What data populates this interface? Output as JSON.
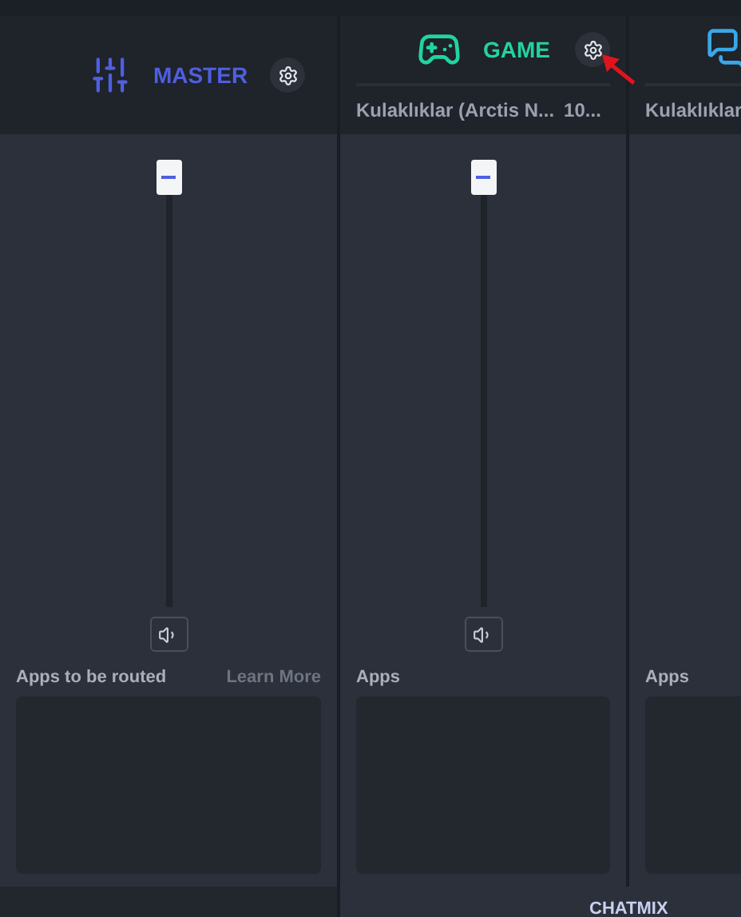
{
  "channels": [
    {
      "kind": "master",
      "name": "MASTER",
      "color": "#4f5fe0",
      "level": 1,
      "apps_label": "Apps to be routed",
      "link": "Learn More",
      "muted": false
    },
    {
      "kind": "game",
      "name": "GAME",
      "color": "#22d3a0",
      "device": "Kulaklıklar (Arctis N...",
      "device_extra": "10...",
      "level": 1,
      "apps_label": "Apps",
      "muted": false,
      "annotated": true
    },
    {
      "kind": "chat",
      "color": "#3aa7e8",
      "device": "Kulaklıklar",
      "apps_label": "Apps"
    }
  ],
  "chatmix": {
    "label": "CHATMIX"
  }
}
